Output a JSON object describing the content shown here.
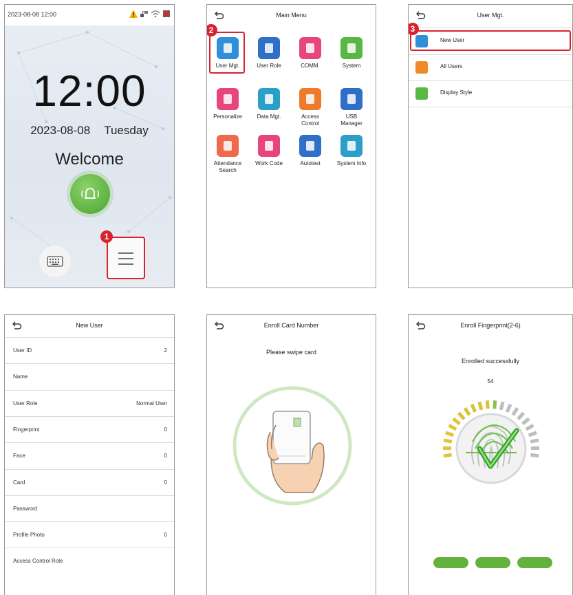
{
  "screen1": {
    "status_time": "2023-08-08 12:00",
    "clock": "12:00",
    "date": "2023-08-08",
    "weekday": "Tuesday",
    "welcome": "Welcome",
    "step_badge": "1"
  },
  "screen2": {
    "title": "Main Menu",
    "step_badge": "2",
    "items": [
      {
        "label": "User Mgt.",
        "icon": "user-icon",
        "color": "#2f8fd8"
      },
      {
        "label": "User Role",
        "icon": "shield-icon",
        "color": "#2f6fc8"
      },
      {
        "label": "COMM.",
        "icon": "satellite-icon",
        "color": "#e8457d"
      },
      {
        "label": "System",
        "icon": "gear-icon",
        "color": "#58b843"
      },
      {
        "label": "Personalize",
        "icon": "palette-icon",
        "color": "#e8457d"
      },
      {
        "label": "Data Mgt.",
        "icon": "database-icon",
        "color": "#2aa0c8"
      },
      {
        "label": "Access\nControl",
        "icon": "door-icon",
        "color": "#ef7a2a"
      },
      {
        "label": "USB\nManager",
        "icon": "usb-icon",
        "color": "#2f6fc8"
      },
      {
        "label": "Attendance\nSearch",
        "icon": "search-doc-icon",
        "color": "#ef6a4a"
      },
      {
        "label": "Work Code",
        "icon": "document-icon",
        "color": "#e8457d"
      },
      {
        "label": "Autotest",
        "icon": "code-icon",
        "color": "#2f6fc8"
      },
      {
        "label": "System Info",
        "icon": "monitor-icon",
        "color": "#2aa0c8"
      }
    ]
  },
  "screen3": {
    "title": "User Mgt.",
    "step_badge": "3",
    "items": [
      {
        "label": "New User",
        "icon": "add-user-icon",
        "color": "#2f8fd8"
      },
      {
        "label": "All Users",
        "icon": "users-list-icon",
        "color": "#ef8a2a"
      },
      {
        "label": "Display Style",
        "icon": "display-style-icon",
        "color": "#58b843"
      }
    ]
  },
  "screen4": {
    "title": "New User",
    "fields": [
      {
        "label": "User ID",
        "value": "2"
      },
      {
        "label": "Name",
        "value": ""
      },
      {
        "label": "User Role",
        "value": "Normal User"
      },
      {
        "label": "Fingerprint",
        "value": "0"
      },
      {
        "label": "Face",
        "value": "0"
      },
      {
        "label": "Card",
        "value": "0"
      },
      {
        "label": "Password",
        "value": ""
      },
      {
        "label": "Profile Photo",
        "value": "0"
      },
      {
        "label": "Access Control Role",
        "value": ""
      }
    ]
  },
  "screen5": {
    "title": "Enroll Card Number",
    "prompt": "Please swipe card"
  },
  "screen6": {
    "title": "Enroll Fingerprint(2-6)",
    "status": "Enrolled successfully",
    "quality": "54",
    "progress_steps_done": 3
  },
  "colors": {
    "highlight": "#d9222b",
    "accent_green": "#62b23c"
  }
}
